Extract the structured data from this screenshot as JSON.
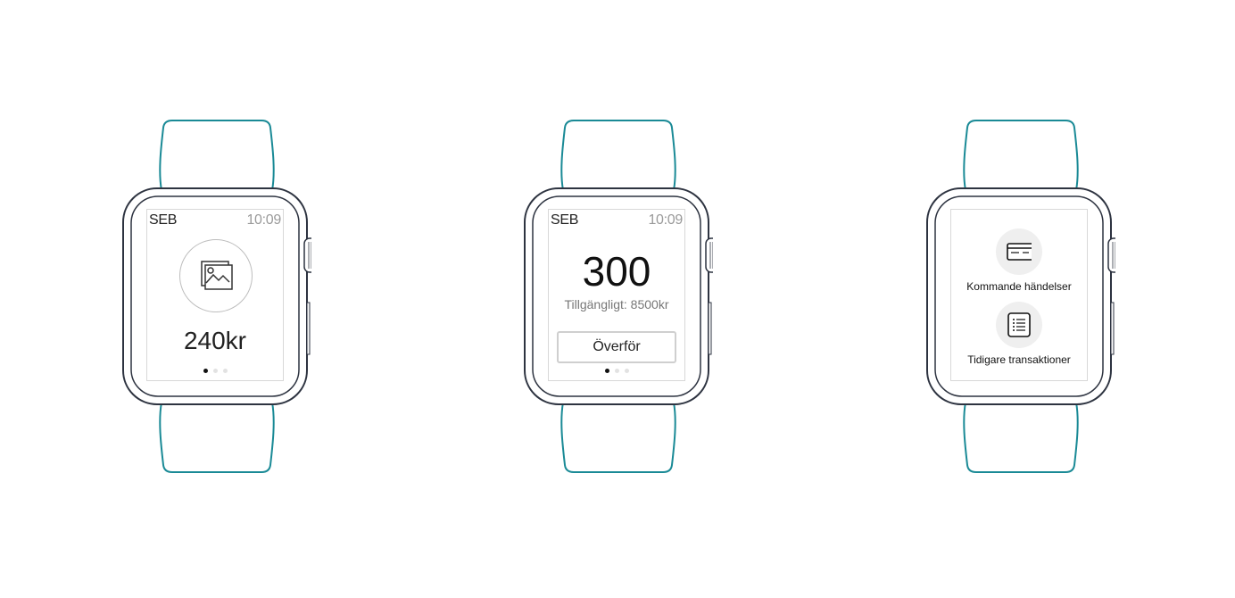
{
  "colors": {
    "band": "#1a8a96",
    "case": "#2d3340"
  },
  "watches": [
    {
      "status": {
        "brand": "SEB",
        "time": "10:09"
      },
      "icon": "image-icon",
      "amount": "240kr",
      "pager": {
        "total": 3,
        "active": 1
      }
    },
    {
      "status": {
        "brand": "SEB",
        "time": "10:09"
      },
      "amount": "300",
      "available": "Tillgängligt: 8500kr",
      "button_label": "Överför",
      "pager": {
        "total": 3,
        "active": 1
      }
    },
    {
      "menu": [
        {
          "icon": "card-icon",
          "label": "Kommande händelser"
        },
        {
          "icon": "list-icon",
          "label": "Tidigare transaktioner"
        }
      ]
    }
  ]
}
